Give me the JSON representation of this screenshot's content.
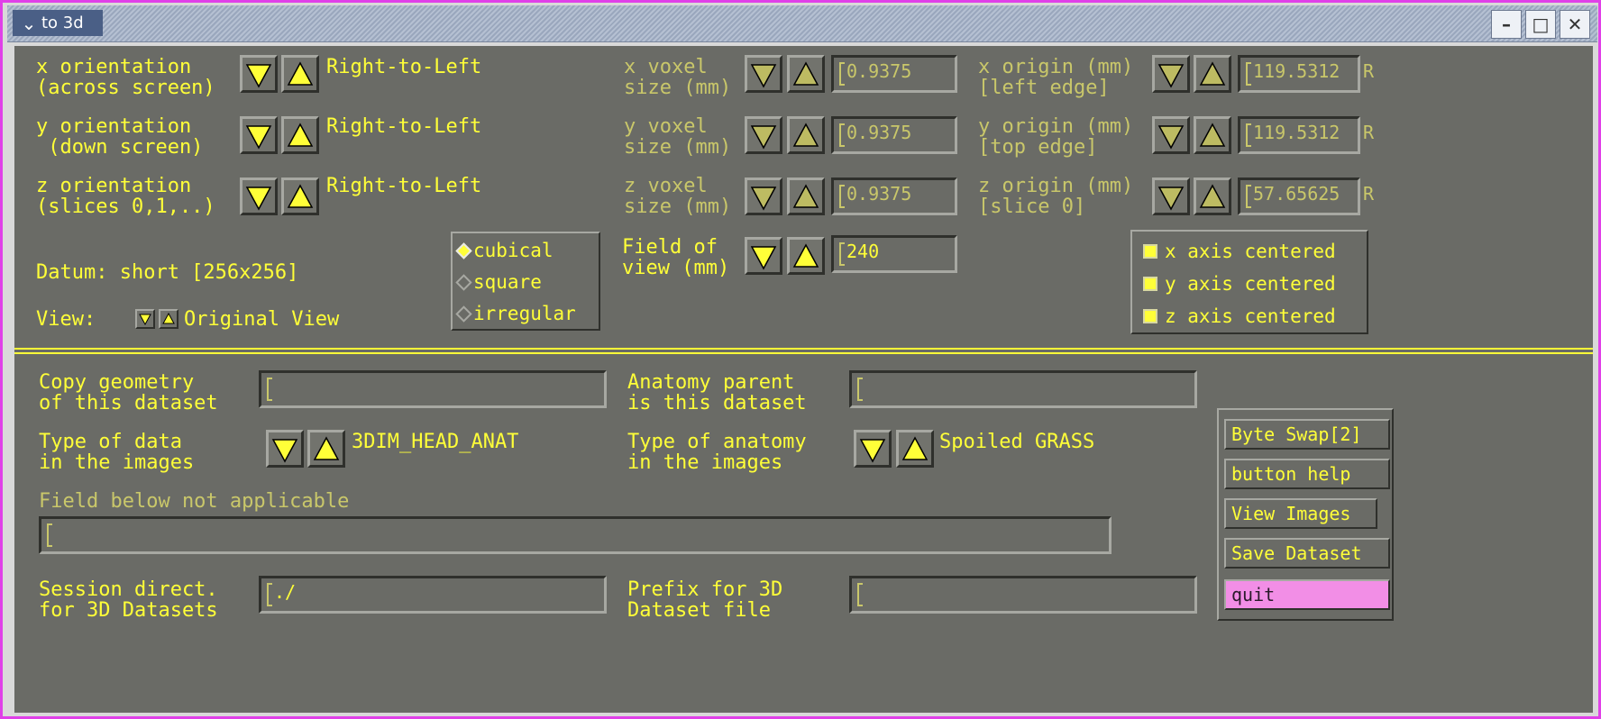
{
  "window": {
    "title": "to 3d"
  },
  "icons": {
    "chevron": "chevron-down-icon",
    "minimize": "minimize-icon",
    "maximize": "maximize-icon",
    "close": "close-icon"
  },
  "orientation": {
    "x": {
      "label": "x orientation\n(across screen)",
      "value": "Right-to-Left"
    },
    "y": {
      "label": "y orientation\n (down screen)",
      "value": "Right-to-Left"
    },
    "z": {
      "label": "z orientation\n(slices 0,1,..)",
      "value": "Right-to-Left"
    }
  },
  "voxel": {
    "x": {
      "label": "x voxel\nsize (mm)",
      "value": "0.9375"
    },
    "y": {
      "label": "y voxel\nsize (mm)",
      "value": "0.9375"
    },
    "z": {
      "label": "z voxel\nsize (mm)",
      "value": "0.9375"
    }
  },
  "origin": {
    "x": {
      "label": "x origin (mm)\n[left edge]",
      "value": "119.5312",
      "suffix": "R"
    },
    "y": {
      "label": "y origin (mm)\n[top edge]",
      "value": "119.5312",
      "suffix": "R"
    },
    "z": {
      "label": "z origin (mm)\n[slice 0]",
      "value": "57.65625",
      "suffix": "R"
    }
  },
  "datum": "Datum: short [256x256]",
  "view": {
    "label": "View:",
    "value": "Original View"
  },
  "shape": {
    "options": [
      "cubical",
      "square",
      "irregular"
    ],
    "selected": "cubical"
  },
  "fov": {
    "label": "Field of\nview (mm)",
    "value": "240"
  },
  "centered": [
    "x axis centered",
    "y axis centered",
    "z axis centered"
  ],
  "copy_geometry": {
    "label": "Copy geometry\nof this dataset",
    "value": ""
  },
  "anatomy_parent": {
    "label": "Anatomy parent\nis this dataset",
    "value": ""
  },
  "data_type": {
    "label": "Type of data\nin the images",
    "value": "3DIM_HEAD_ANAT"
  },
  "anatomy_type": {
    "label": "Type of anatomy\nin the images",
    "value": "Spoiled GRASS"
  },
  "na_field": {
    "label": "Field below not applicable",
    "value": ""
  },
  "session": {
    "label": "Session direct.\nfor 3D Datasets",
    "value": "./"
  },
  "prefix": {
    "label": "Prefix for 3D\nDataset file",
    "value": ""
  },
  "buttons": {
    "byte_swap": "Byte Swap[2]",
    "help": "button help",
    "view_images": "View Images",
    "save": "Save Dataset",
    "quit": "quit"
  },
  "colors": {
    "label": "#ffff38",
    "panel": "#6a6b66",
    "quit_bg": "#f28ee6",
    "window_border": "#e040e8"
  }
}
